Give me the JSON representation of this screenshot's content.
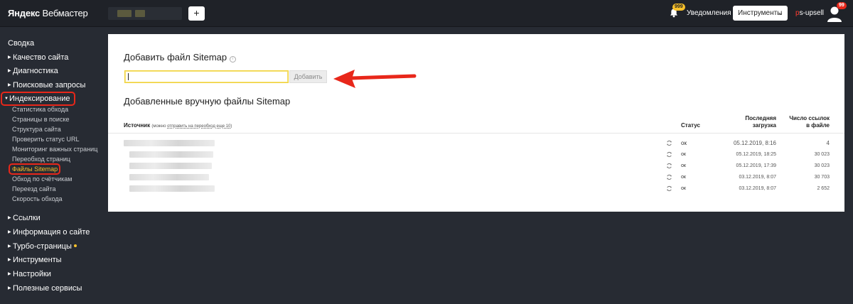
{
  "header": {
    "logo_brand": "Яндекс",
    "logo_product": "Вебмастер",
    "add_site_label": "+",
    "notifications_badge": "999",
    "notifications_label": "Уведомления",
    "tools_label": "Инструменты",
    "user_first": "p",
    "user_rest": "s-upsell",
    "avatar_badge": "99"
  },
  "sidebar": {
    "items": [
      {
        "label": "Сводка"
      },
      {
        "label": "Качество сайта"
      },
      {
        "label": "Диагностика"
      },
      {
        "label": "Поисковые запросы"
      },
      {
        "label": "Индексирование"
      },
      {
        "label": "Ссылки"
      },
      {
        "label": "Информация о сайте"
      },
      {
        "label": "Турбо-страницы"
      },
      {
        "label": "Инструменты"
      },
      {
        "label": "Настройки"
      },
      {
        "label": "Полезные сервисы"
      }
    ],
    "indexing_sub": [
      "Статистика обхода",
      "Страницы в поиске",
      "Структура сайта",
      "Проверить статус URL",
      "Мониторинг важных страниц",
      "Переобход страниц",
      "Файлы Sitemap",
      "Обход по счётчикам",
      "Переезд сайта",
      "Скорость обхода"
    ]
  },
  "main": {
    "add_title": "Добавить файл Sitemap",
    "info_glyph": "i",
    "input_value": "",
    "add_button": "Добавить",
    "list_title": "Добавленные вручную файлы Sitemap",
    "table": {
      "col_source": "Источник",
      "col_source_note_prefix": "(можно ",
      "col_source_note_link": "отправить на переобход еще 10",
      "col_source_note_suffix": ")",
      "col_status": "Статус",
      "col_date_1": "Последняя",
      "col_date_2": "загрузка",
      "col_links_1": "Число ссылок",
      "col_links_2": "в файле",
      "rows": [
        {
          "status": "ок",
          "date": "05.12.2019, 8:16",
          "links": "4"
        },
        {
          "status": "ок",
          "date": "05.12.2019, 18:25",
          "links": "30 023"
        },
        {
          "status": "ок",
          "date": "05.12.2019, 17:39",
          "links": "30 023"
        },
        {
          "status": "ок",
          "date": "03.12.2019, 8:07",
          "links": "30 703"
        },
        {
          "status": "ок",
          "date": "03.12.2019, 8:07",
          "links": "2 652"
        }
      ]
    }
  },
  "colors": {
    "background": "#272b33",
    "header": "#1f2228",
    "highlight": "#e8271a",
    "accent_yellow": "#f7c02a"
  }
}
